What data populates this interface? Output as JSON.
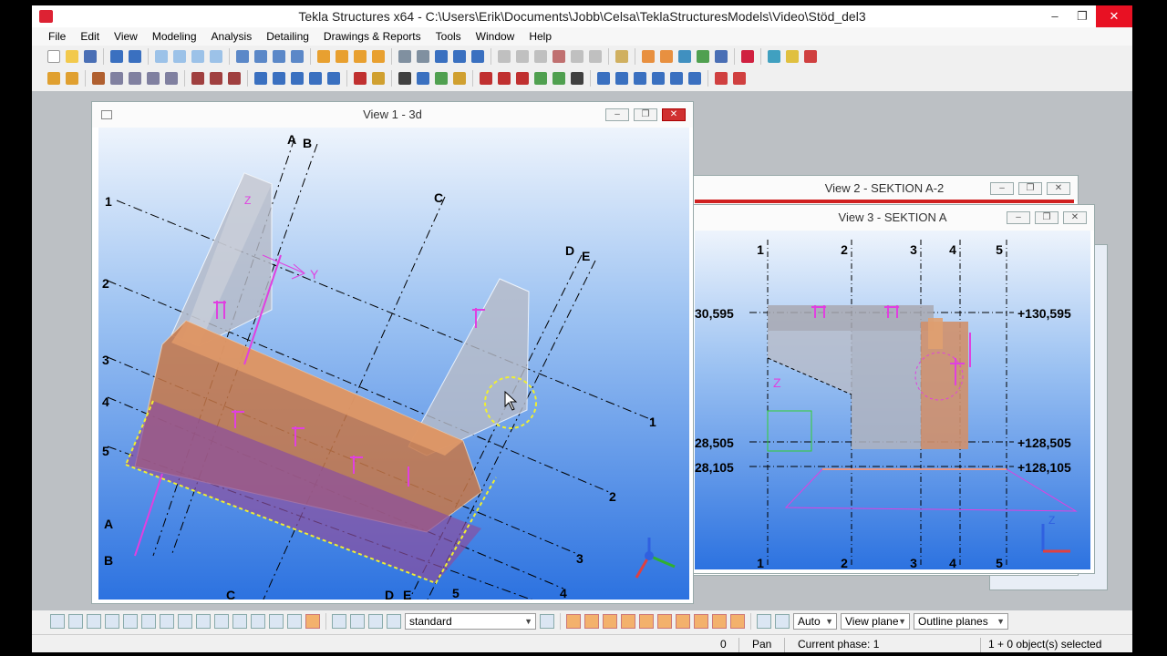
{
  "app": {
    "title": "Tekla Structures x64 - C:\\Users\\Erik\\Documents\\Jobb\\Celsa\\TeklaStructuresModels\\Video\\Stöd_del3"
  },
  "window_controls": {
    "minimize": "–",
    "restore": "❐",
    "close": "✕"
  },
  "menu": [
    "File",
    "Edit",
    "View",
    "Modeling",
    "Analysis",
    "Detailing",
    "Drawings & Reports",
    "Tools",
    "Window",
    "Help"
  ],
  "views": {
    "view1": {
      "title": "View 1 - 3d",
      "grid_letters": [
        "A",
        "B",
        "C",
        "D",
        "E"
      ],
      "grid_numbers": [
        "1",
        "2",
        "3",
        "4",
        "5"
      ],
      "axes": {
        "x": "",
        "y": "Y",
        "z": "Z"
      }
    },
    "view2": {
      "title": "View 2 - SEKTION A-2"
    },
    "view3": {
      "title": "View 3 - SEKTION A",
      "grid_numbers": [
        "1",
        "2",
        "3",
        "4",
        "5"
      ],
      "levels": {
        "l1_left": "30,595",
        "l1_right": "+130,595",
        "l2_left": "28,505",
        "l2_right": "+128,505",
        "l3_left": "28,105",
        "l3_right": "+128,105"
      },
      "z_label": "Z"
    }
  },
  "bottom_toolbar": {
    "selection_filter": "standard",
    "snap_mode": "Auto",
    "plane_mode": "View plane",
    "outline_mode": "Outline planes"
  },
  "statusbar": {
    "value": "0",
    "command": "Pan",
    "phase": "Current phase: 1",
    "selection": "1 + 0 object(s) selected"
  },
  "colors": {
    "accent_red": "#e81123",
    "view_background_top": "#eef4fc",
    "view_background_bottom": "#2c72e0",
    "magenta": "#e040e0",
    "selection_yellow": "#f0f030",
    "concrete_orange": "#c87848"
  }
}
